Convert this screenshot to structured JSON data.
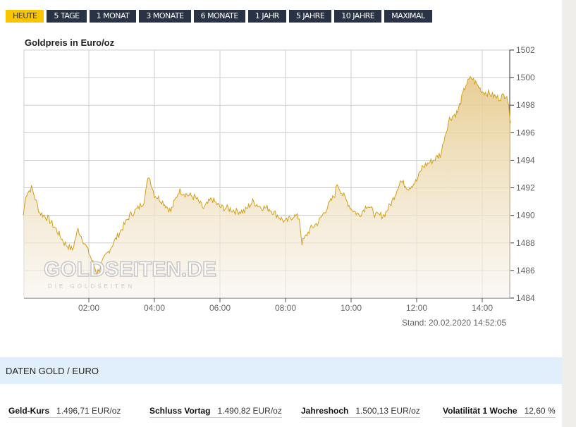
{
  "tabs": [
    "HEUTE",
    "5 TAGE",
    "1 MONAT",
    "3 MONATE",
    "6 MONATE",
    "1 JAHR",
    "5 JAHRE",
    "10 JAHRE",
    "MAXIMAL"
  ],
  "active_tab": "HEUTE",
  "chart_data": {
    "type": "area",
    "title": "Goldpreis in Euro/oz",
    "ylim": [
      1484,
      1502
    ],
    "yticks": [
      1484,
      1486,
      1488,
      1490,
      1492,
      1494,
      1496,
      1498,
      1500,
      1502
    ],
    "xticks": [
      "02:00",
      "04:00",
      "06:00",
      "08:00",
      "10:00",
      "12:00",
      "14:00"
    ],
    "xtick_hours": [
      2,
      4,
      6,
      8,
      10,
      12,
      14
    ],
    "xlim_hours": [
      0,
      14.87
    ],
    "color": "#d4a017",
    "x": [
      0,
      0.08,
      0.25,
      0.33,
      0.5,
      0.75,
      1,
      1.25,
      1.5,
      1.67,
      2,
      2.25,
      2.5,
      2.75,
      3,
      3.25,
      3.5,
      3.67,
      3.83,
      4,
      4.25,
      4.5,
      4.75,
      5,
      5.25,
      5.5,
      5.75,
      6,
      6.25,
      6.5,
      6.75,
      7,
      7.25,
      7.5,
      7.75,
      8,
      8.25,
      8.42,
      8.5,
      8.75,
      9,
      9.25,
      9.5,
      9.58,
      9.75,
      10,
      10.25,
      10.5,
      10.75,
      11,
      11.25,
      11.5,
      11.75,
      12,
      12.17,
      12.5,
      12.75,
      12.83,
      13,
      13.25,
      13.5,
      13.67,
      14,
      14.25,
      14.5,
      14.75,
      14.87
    ],
    "y": [
      1490,
      1491.5,
      1492,
      1491.5,
      1490.2,
      1489.8,
      1489,
      1488,
      1487.5,
      1489,
      1487.3,
      1485.8,
      1487,
      1488,
      1489,
      1490,
      1490.5,
      1491,
      1492.9,
      1491.5,
      1491,
      1490.3,
      1491.8,
      1491.5,
      1491.3,
      1490.5,
      1491.2,
      1490.6,
      1490.5,
      1490.3,
      1490.3,
      1491,
      1490.6,
      1490.5,
      1490,
      1489.5,
      1490,
      1489.8,
      1488,
      1489,
      1489.5,
      1490.5,
      1491.5,
      1492.3,
      1491.5,
      1490.5,
      1490,
      1490.8,
      1490,
      1490,
      1491,
      1492.5,
      1492,
      1492.5,
      1493.5,
      1494,
      1494.5,
      1495.5,
      1497,
      1497.5,
      1499.5,
      1500,
      1499,
      1498.8,
      1498.5,
      1498.8,
      1496.7
    ]
  },
  "watermark": {
    "main": "GOLDSEITEN.DE",
    "sub": "DIE GOLDSEITEN"
  },
  "stand": "Stand: 20.02.2020 14:52:05",
  "section_title": "DATEN GOLD / EURO",
  "stats": [
    {
      "label": "Geld-Kurs",
      "value": "1.496,71 EUR/oz"
    },
    {
      "label": "Schluss Vortag",
      "value": "1.490,82 EUR/oz"
    },
    {
      "label": "Jahreshoch",
      "value": "1.500,13 EUR/oz"
    },
    {
      "label": "Volatilität 1 Woche",
      "value": "12,60 %"
    }
  ]
}
